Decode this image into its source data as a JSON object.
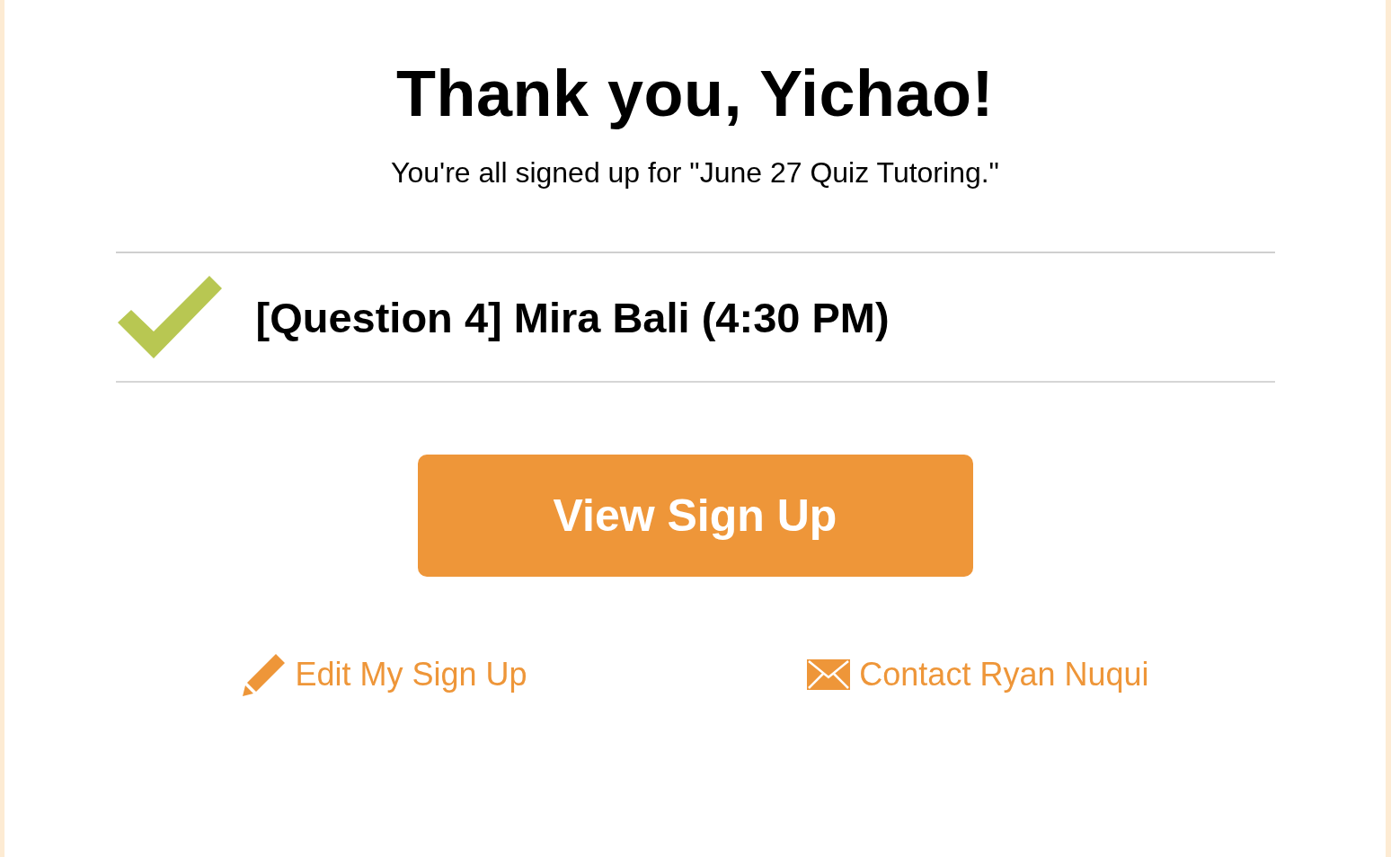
{
  "title": "Thank you, Yichao!",
  "subtitle": "You're all signed up for \"June 27 Quiz Tutoring.\"",
  "slots": [
    {
      "text": "[Question 4] Mira Bali (4:30 PM)"
    }
  ],
  "primary_button": "View Sign Up",
  "links": [
    {
      "kind": "edit",
      "label": "Edit My Sign Up"
    },
    {
      "kind": "contact",
      "label": "Contact Ryan Nuqui"
    }
  ]
}
